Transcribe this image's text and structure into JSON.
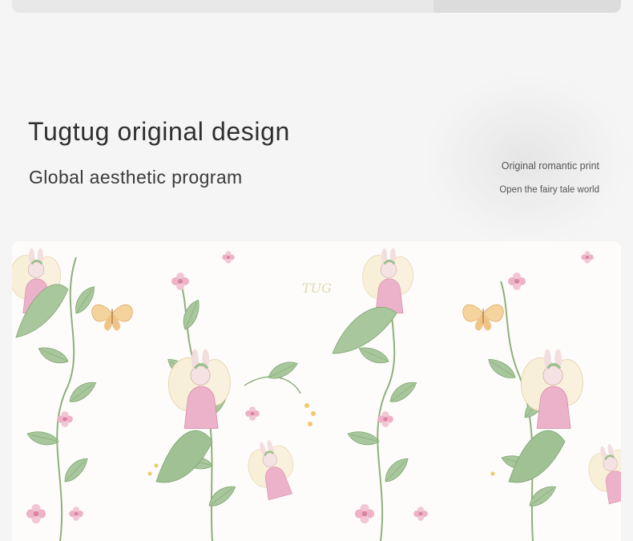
{
  "hero": {
    "title": "Tugtug original design",
    "subtitle": "Global aesthetic program"
  },
  "tagline": {
    "line1": "Original romantic print",
    "line2": "Open the fairy tale world"
  },
  "pattern": {
    "watermark": "TUG",
    "colors": {
      "background": "#fdfcfb",
      "leaf": "#9bbf8e",
      "leaf_dark": "#6f9a6a",
      "petal_pink": "#e8b4c8",
      "wing_cream": "#f6e7c9",
      "butterfly": "#f1c68a",
      "stem": "#8fb07c"
    }
  }
}
